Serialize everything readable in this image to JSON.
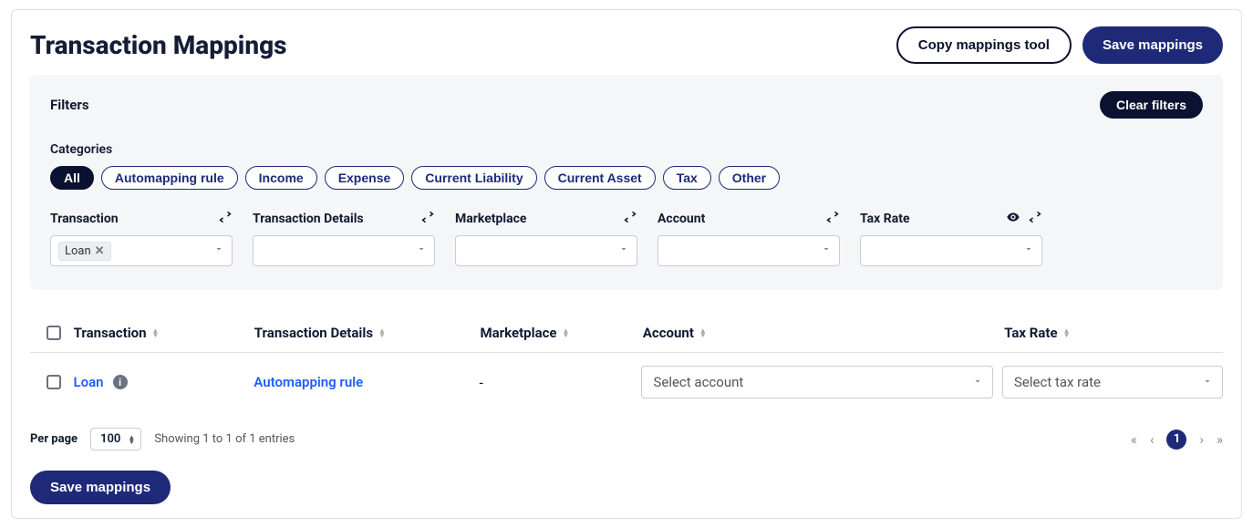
{
  "header": {
    "title": "Transaction Mappings",
    "copy_tool": "Copy mappings tool",
    "save": "Save mappings"
  },
  "filters": {
    "label": "Filters",
    "clear": "Clear filters",
    "categories_label": "Categories",
    "categories": [
      "All",
      "Automapping rule",
      "Income",
      "Expense",
      "Current Liability",
      "Current Asset",
      "Tax",
      "Other"
    ],
    "active_category_index": 0,
    "columns": {
      "transaction": {
        "label": "Transaction",
        "tag": "Loan"
      },
      "details": {
        "label": "Transaction Details"
      },
      "marketplace": {
        "label": "Marketplace"
      },
      "account": {
        "label": "Account"
      },
      "taxrate": {
        "label": "Tax Rate"
      }
    }
  },
  "table": {
    "headers": {
      "transaction": "Transaction",
      "details": "Transaction Details",
      "marketplace": "Marketplace",
      "account": "Account",
      "taxrate": "Tax Rate"
    },
    "rows": [
      {
        "transaction": "Loan",
        "details": "Automapping rule",
        "marketplace": "-",
        "account_placeholder": "Select account",
        "tax_placeholder": "Select tax rate"
      }
    ]
  },
  "pagination": {
    "per_page_label": "Per page",
    "per_page_value": "100",
    "showing": "Showing 1 to 1 of 1 entries",
    "current_page": "1"
  },
  "footer": {
    "save": "Save mappings"
  }
}
